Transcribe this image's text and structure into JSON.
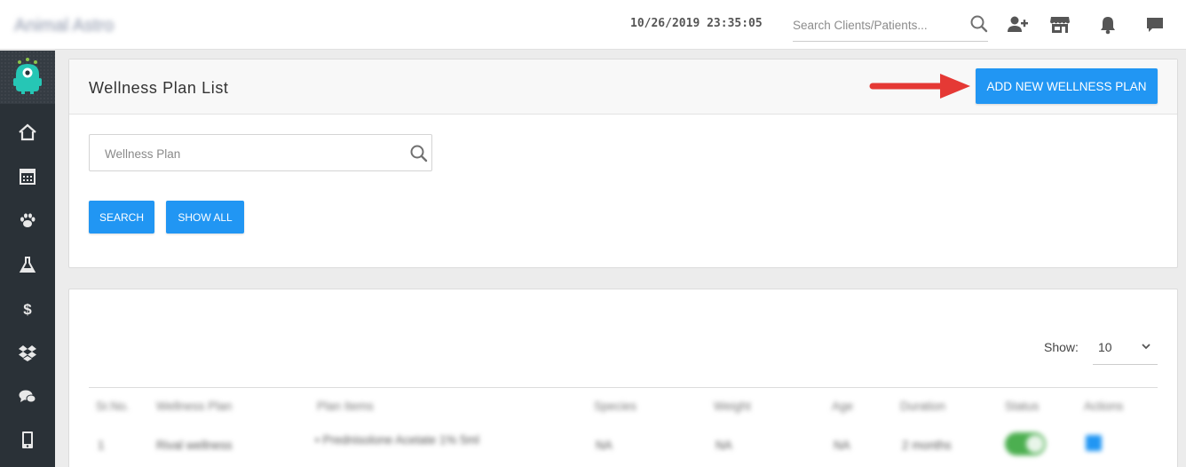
{
  "header": {
    "app_name": "Animal Astro",
    "datetime": "10/26/2019 23:35:05",
    "search_placeholder": "Search Clients/Patients..."
  },
  "icons": {
    "top": [
      "search-icon",
      "add-user-icon",
      "store-icon",
      "bell-icon",
      "chat-icon"
    ],
    "sidebar": [
      "home-icon",
      "calendar-icon",
      "paw-icon",
      "flask-icon",
      "dollar-icon",
      "dropbox-icon",
      "comments-icon",
      "tablet-icon"
    ]
  },
  "colors": {
    "accent": "#2196f3",
    "sidebar": "#2a3137",
    "annotation_arrow": "#e53935",
    "logo": "#26c6b5",
    "toggle_on": "#4caf50"
  },
  "page": {
    "title": "Wellness Plan List",
    "add_button": "ADD NEW WELLNESS PLAN",
    "filter_placeholder": "Wellness Plan",
    "search_button": "SEARCH",
    "show_all_button": "SHOW ALL"
  },
  "list": {
    "show_label": "Show:",
    "page_size": "10",
    "columns": [
      "Sr.No.",
      "Wellness Plan",
      "Plan Items",
      "Species",
      "Weight",
      "Age",
      "Duration",
      "Status",
      "Actions"
    ],
    "rows": [
      {
        "sr": "1",
        "plan": "Rival wellness",
        "item": "Prednisolone Acetate 1% 5ml",
        "species": "NA",
        "weight": "NA",
        "age": "NA",
        "duration": "2 months",
        "status_on": true
      }
    ]
  }
}
